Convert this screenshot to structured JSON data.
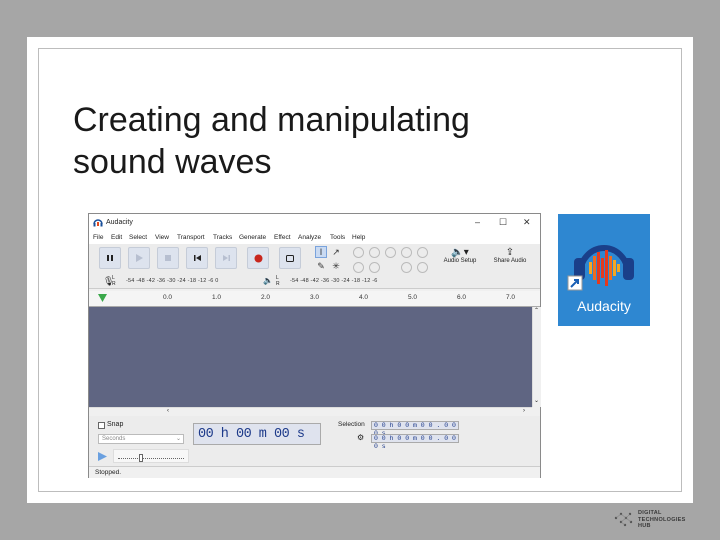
{
  "slide": {
    "title_line1": "Creating and manipulating",
    "title_line2": "sound waves"
  },
  "window": {
    "title": "Audacity",
    "controls": [
      "–",
      "☐",
      "✕"
    ]
  },
  "menu": [
    "File",
    "Edit",
    "Select",
    "View",
    "Transport",
    "Tracks",
    "Generate",
    "Effect",
    "Analyze",
    "Tools",
    "Help"
  ],
  "toolbar": {
    "audio_setup_label": "Audio Setup",
    "share_audio_label": "Share Audio"
  },
  "meters": {
    "record_lr": "L\nR",
    "record_scale": "-54 -48 -42 -36 -30 -24 -18 -12 -6 0",
    "play_lr": "L\nR",
    "play_scale": "-54 -48 -42 -36 -30 -24 -18 -12 -6"
  },
  "ruler": {
    "ticks": [
      "0.0",
      "1.0",
      "2.0",
      "3.0",
      "4.0",
      "5.0",
      "6.0",
      "7.0"
    ]
  },
  "bottom": {
    "snap_label": "Snap",
    "snap_units": "Seconds",
    "time_display": "00 h 00 m 00 s",
    "selection_label": "Selection",
    "sel_start": "0 0 h 0 0 m 0 0 . 0 0 0 s",
    "sel_end": "0 0 h 0 0 m 0 0 . 0 0 0 s"
  },
  "status": {
    "text": "Stopped."
  },
  "app_icon": {
    "label": "Audacity"
  },
  "logo": {
    "text": "DIGITAL\nTECHNOLOGIES\nHUB"
  },
  "colors": {
    "track_bg": "#5f6582",
    "icon_bg": "#2e87d1",
    "record_red": "#c8261d"
  }
}
